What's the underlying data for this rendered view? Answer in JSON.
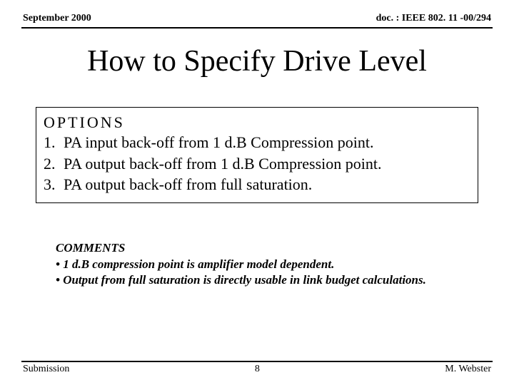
{
  "header": {
    "left": "September 2000",
    "right": "doc. : IEEE 802. 11 -00/294"
  },
  "title": "How to Specify Drive Level",
  "options": {
    "heading": "OPTIONS",
    "items": [
      "PA input back-off from 1 d.B Compression point.",
      "PA output back-off from 1 d.B Compression point.",
      "PA output back-off from full saturation."
    ]
  },
  "comments": {
    "heading": "COMMENTS",
    "items": [
      "1 d.B compression point is amplifier model dependent.",
      "Output from full saturation is directly usable in link budget calculations."
    ]
  },
  "footer": {
    "left": "Submission",
    "center": "8",
    "right": "M. Webster"
  }
}
